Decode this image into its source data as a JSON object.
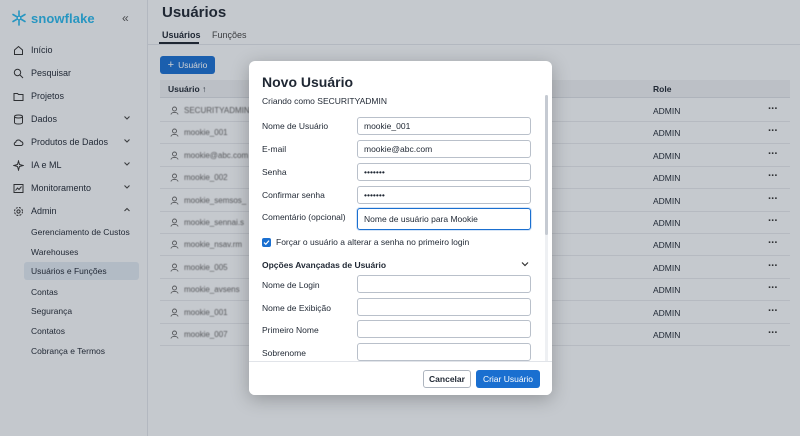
{
  "app": {
    "brand": "snowflake",
    "accent": "#29b5e8",
    "primary": "#1a6fd0"
  },
  "sidebar": {
    "collapse_icon": "chevrons-left-icon",
    "items": [
      {
        "label": "Início",
        "icon": "home-icon"
      },
      {
        "label": "Pesquisar",
        "icon": "search-icon"
      },
      {
        "label": "Projetos",
        "icon": "folder-icon"
      },
      {
        "label": "Dados",
        "icon": "database-icon",
        "chevron": "down"
      },
      {
        "label": "Produtos de Dados",
        "icon": "cloud-icon",
        "chevron": "down"
      },
      {
        "label": "IA e ML",
        "icon": "ai-icon",
        "chevron": "down"
      },
      {
        "label": "Monitoramento",
        "icon": "chart-icon",
        "chevron": "down"
      },
      {
        "label": "Admin",
        "icon": "gear-icon",
        "chevron": "up"
      }
    ],
    "sub_items": [
      {
        "label": "Gerenciamento de Custos"
      },
      {
        "label": "Warehouses"
      },
      {
        "label": "Usuários e Funções",
        "active": true
      },
      {
        "label": "Contas"
      },
      {
        "label": "Segurança"
      },
      {
        "label": "Contatos"
      },
      {
        "label": "Cobrança e Termos"
      }
    ]
  },
  "main": {
    "title": "Usuários",
    "tabs": [
      {
        "label": "Usuários",
        "active": true
      },
      {
        "label": "Funções"
      }
    ],
    "add_button": "Usuário",
    "table": {
      "columns": {
        "user": "Usuário ↑",
        "role": "Role"
      },
      "rows": [
        {
          "name": "SECURITYADMIN",
          "role": "ADMIN"
        },
        {
          "name": "mookie_001",
          "role": "ADMIN"
        },
        {
          "name": "mookie@abc.com",
          "role": "ADMIN"
        },
        {
          "name": "mookie_002",
          "role": "ADMIN"
        },
        {
          "name": "mookie_semsos_",
          "role": "ADMIN"
        },
        {
          "name": "mookie_sennai.s",
          "role": "ADMIN"
        },
        {
          "name": "mookie_nsav.rm",
          "role": "ADMIN"
        },
        {
          "name": "mookie_005",
          "role": "ADMIN"
        },
        {
          "name": "mookie_avsens",
          "role": "ADMIN"
        },
        {
          "name": "mookie_001",
          "role": "ADMIN"
        },
        {
          "name": "mookie_007",
          "role": "ADMIN"
        }
      ]
    }
  },
  "modal": {
    "title": "Novo Usuário",
    "subtitle": "Criando como SECURITYADMIN",
    "fields": {
      "username": {
        "label": "Nome de Usuário",
        "value": "mookie_001"
      },
      "email": {
        "label": "E-mail",
        "value": "mookie@abc.com"
      },
      "password": {
        "label": "Senha",
        "value": "•••••••"
      },
      "confirm": {
        "label": "Confirmar senha",
        "value": "•••••••"
      },
      "comment": {
        "label": "Comentário (opcional)",
        "value": "Nome de usuário para Mookie"
      }
    },
    "force_change": {
      "label": "Forçar o usuário a alterar a senha no primeiro login",
      "checked": true
    },
    "advanced": {
      "title": "Opções Avançadas de Usuário",
      "login_name": {
        "label": "Nome de Login",
        "value": ""
      },
      "display_name": {
        "label": "Nome de Exibição",
        "value": ""
      },
      "first_name": {
        "label": "Primeiro Nome",
        "value": ""
      },
      "last_name": {
        "label": "Sobrenome",
        "value": ""
      }
    },
    "cancel": "Cancelar",
    "create": "Criar Usuário"
  }
}
